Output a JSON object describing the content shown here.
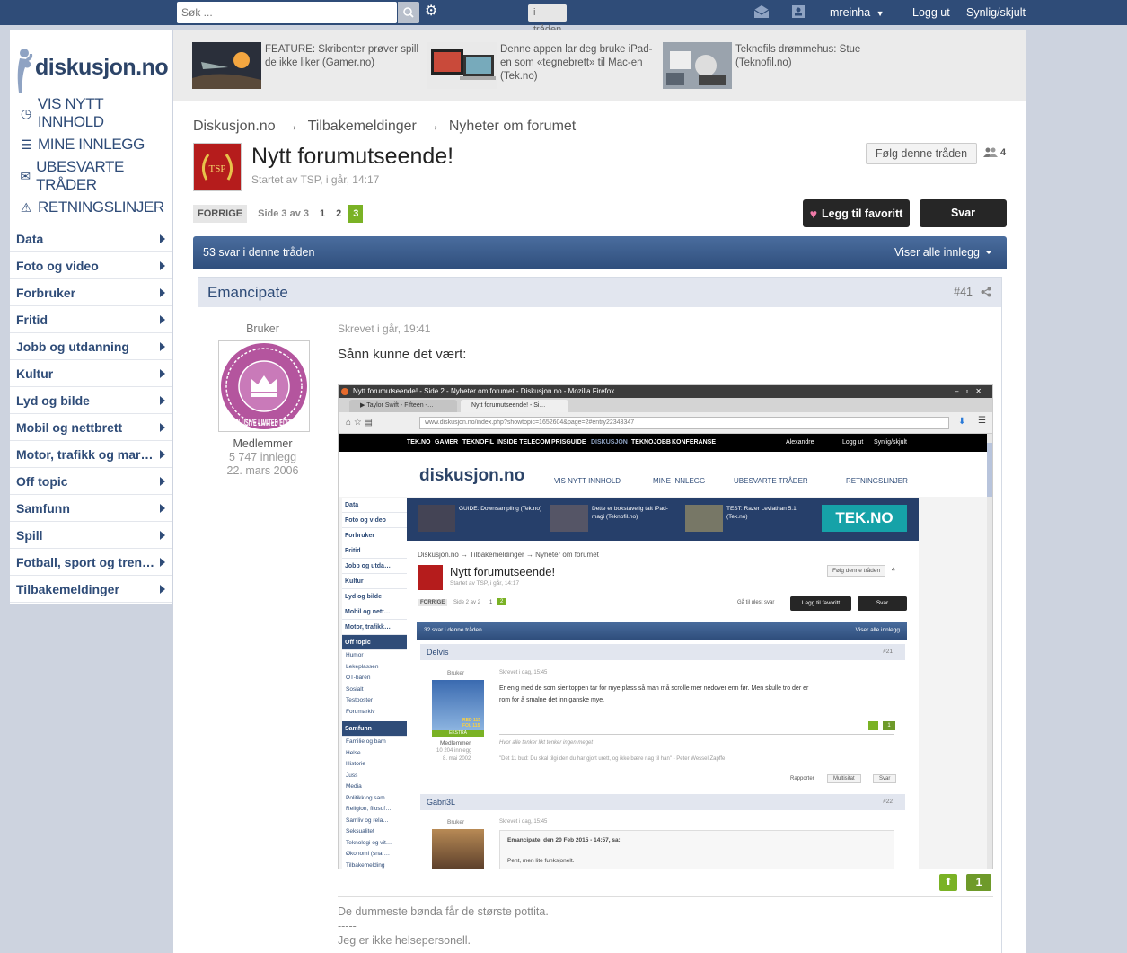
{
  "topbar": {
    "search_placeholder": "Søk ...",
    "search_scope": "i tråden",
    "username": "mreinha",
    "logout": "Logg ut",
    "toggle": "Synlig/skjult"
  },
  "sidebar": {
    "logo": "diskusjon.no",
    "quick_links": [
      {
        "label": "VIS NYTT INNHOLD",
        "icon": "clock-icon"
      },
      {
        "label": "MINE INNLEGG",
        "icon": "list-icon"
      },
      {
        "label": "UBESVARTE TRÅDER",
        "icon": "envelope-icon"
      },
      {
        "label": "RETNINGSLINJER",
        "icon": "warning-icon"
      }
    ],
    "categories": [
      "Data",
      "Foto og video",
      "Forbruker",
      "Fritid",
      "Jobb og utdanning",
      "Kultur",
      "Lyd og bilde",
      "Mobil og nettbrett",
      "Motor, trafikk og mar…",
      "Off topic",
      "Samfunn",
      "Spill",
      "Fotball, sport og tren…",
      "Tilbakemeldinger"
    ]
  },
  "promos": [
    {
      "text": "FEATURE: Skribenter prøver spill de ikke liker (Gamer.no)"
    },
    {
      "text": "Denne appen lar deg bruke iPad-en som «tegnebrett» til Mac-en (Tek.no)"
    },
    {
      "text": "Teknofils drømmehus: Stue (Teknofil.no)"
    }
  ],
  "breadcrumb": [
    "Diskusjon.no",
    "Tilbakemeldinger",
    "Nyheter om forumet"
  ],
  "breadcrumb_sep": "→",
  "topic": {
    "title": "Nytt forumutseende!",
    "meta": "Startet av TSP, i går, 14:17",
    "avatar_text": "TSP",
    "follow": "Følg denne tråden",
    "followers": "4"
  },
  "pagination": {
    "prev": "FORRIGE",
    "page_of": "Side 3 av 3",
    "pages": [
      "1",
      "2",
      "3"
    ],
    "current": "3"
  },
  "actions": {
    "favorite": "Legg til favoritt",
    "reply": "Svar"
  },
  "thread_bar": {
    "count": "53 svar i denne tråden",
    "view_all": "Viser alle innlegg"
  },
  "post": {
    "author": "Emancipate",
    "number": "#41",
    "rank": "Bruker",
    "group": "Medlemmer",
    "posts": "5 747 innlegg",
    "joined": "22. mars 2006",
    "date": "Skrevet i går, 19:41",
    "text": "Sånn kunne det vært:",
    "votes": "1",
    "signature": [
      "De dummeste bønda får de største pottita.",
      "-----",
      "Jeg er ikke helsepersonell."
    ],
    "avatar_badge": "EXCLUSIVE LIMITED EDITION"
  },
  "embedded": {
    "window_title": "Nytt forumutseende! - Side 2 - Nyheter om forumet - Diskusjon.no - Mozilla Firefox",
    "tabs": [
      "▶ Taylor Swift - Fifteen -…",
      "Nytt forumutseende! - Si…"
    ],
    "url": "www.diskusjon.no/index.php?showtopic=1652604&page=2#entry22343347",
    "topnav": [
      "TEK.NO",
      "GAMER",
      "TEKNOFIL",
      "INSIDE TELECOM",
      "PRISGUIDE",
      "DISKUSJON",
      "TEKNOJOBB",
      "KONFERANSE",
      "Alexandre",
      "Logg ut",
      "Synlig/skjult"
    ],
    "logo": "diskusjon.no",
    "quick_links": [
      "VIS NYTT INNHOLD",
      "MINE INNLEGG",
      "UBESVARTE TRÅDER",
      "RETNINGSLINJER"
    ],
    "categories": [
      "Data",
      "Foto og video",
      "Forbruker",
      "Fritid",
      "Jobb og utda…",
      "Kultur",
      "Lyd og bilde",
      "Mobil og nett…",
      "Motor, trafikk…"
    ],
    "off_topic": "Off topic",
    "off_topic_subs": [
      "Humor",
      "Lekeplassen",
      "OT-baren",
      "Sosialt",
      "Testposter",
      "Forumarkiv"
    ],
    "samfunn": "Samfunn",
    "samfunn_subs": [
      "Familie og barn",
      "Helse",
      "Historie",
      "Juss",
      "Media",
      "Politikk og sam…",
      "Religion, filosof…",
      "Samliv og rela…",
      "Seksualitet",
      "Teknologi og vit…",
      "Økonomi (snar…",
      "Tilbakemelding"
    ],
    "promos": [
      "GUIDE: Downsampling (Tek.no)",
      "Dette er bokstavelig talt iPad-magi (Teknofil.no)",
      "TEST: Razer Leviathan 5.1 (Tek.no)"
    ],
    "tekno_logo": "TEK.NO",
    "breadcrumb": "Diskusjon.no  →  Tilbakemeldinger  →  Nyheter om forumet",
    "title": "Nytt forumutseende!",
    "meta": "Startet av TSP, i går, 14:17",
    "follow": "Følg denne tråden",
    "followers": "4",
    "prev": "FORRIGE",
    "page_of": "Side 2 av 2",
    "pages": [
      "1",
      "2"
    ],
    "unread": "Gå til ulest svar",
    "fav": "Legg til favoritt",
    "reply": "Svar",
    "bar_count": "32 svar i denne tråden",
    "bar_view": "Viser alle innlegg",
    "post1": {
      "author": "Delvis",
      "num": "#21",
      "rank": "Bruker",
      "date": "Skrevet i dag, 15:45",
      "text1": "Er enig med de som sier toppen tar for mye plass så man må scrolle mer nedover enn før. Men skulle tro der er",
      "text2": "rom for å smalne det inn ganske mye.",
      "group": "Medlemmer",
      "posts": "10 204 innlegg",
      "joined": "8. mai 2002",
      "sig1": "Hvor alle tenker likt tenker ingen meget",
      "sig2": "\"Det 11 bud: Du skal tilgi den du har gjort urett, og ikke bære nag til han\" - Peter Wessel Zapffe",
      "report": "Rapporter",
      "multi": "Multisitat",
      "reply": "Svar",
      "votes": "1",
      "badge": "EKSTRA",
      "avatar_text": "RED 115 FOL 115"
    },
    "post2": {
      "author": "Gabri3L",
      "num": "#22",
      "rank": "Bruker",
      "date": "Skrevet i dag, 15:45",
      "quote_head": "Emancipate, den 20 Feb 2015 - 14:57, sa:",
      "quote_text": "Pent, men lite funksjonelt."
    }
  }
}
